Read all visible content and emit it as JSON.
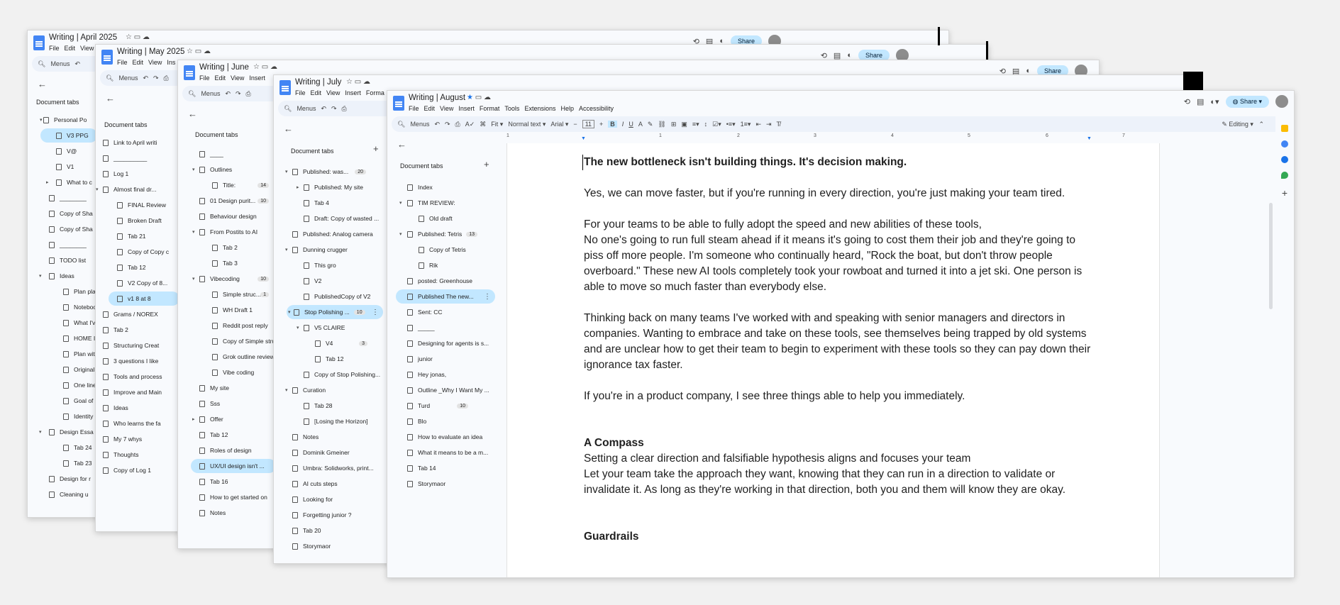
{
  "w1": {
    "title": "Writing | April 2025",
    "menus": [
      "File",
      "Edit",
      "View"
    ],
    "search": "Menus",
    "share": "Share",
    "tabs": [
      "Personal Po",
      "V3 PPG",
      "V@",
      "V1",
      "What to c",
      "________",
      "Copy of Sha",
      "Copy of Sha",
      "________",
      "TODO list",
      "Ideas",
      "Plan plan",
      "Notebook",
      "What I've",
      "HOME Im",
      "Plan with",
      "Original t",
      "One liner",
      "Goal of b",
      "Identity",
      "Design Essa",
      "Tab 24",
      "Tab 23",
      "Design for r",
      "Cleaning u"
    ]
  },
  "w2": {
    "title": "Writing | May 2025",
    "menus": [
      "File",
      "Edit",
      "View",
      "Ins"
    ],
    "search": "Menus",
    "share": "Share",
    "tabs": [
      "Link to April writi",
      "__________",
      "Log 1",
      "Almost final dr...",
      "FINAL Review",
      "Broken Draft",
      "Tab 21",
      "Copy of Copy c",
      "Tab 12",
      "V2 Copy of 8...",
      "v1 8 at 8",
      "Grams / NOREX",
      "Tab 2",
      "Structuring Creat",
      "3 questions I like",
      "Tools and process",
      "Improve and Main",
      "Ideas",
      "Who learns the fa",
      "My 7 whys",
      "Thoughts",
      "Copy of Log 1"
    ]
  },
  "w3": {
    "title": "Writing | June",
    "menus": [
      "File",
      "Edit",
      "View",
      "Insert"
    ],
    "search": "Menus",
    "share": "Share",
    "tabs": [
      "____",
      "Outlines",
      "Title:",
      "01 Design purit...",
      "Behaviour design",
      "From Postits to AI",
      "Tab 2",
      "Tab 3",
      "Vibecoding",
      "Simple struc...",
      "WH Draft 1",
      "Reddit post reply",
      "Copy of Simple stru",
      "Grok outline review",
      "Vibe coding",
      "My site",
      "Sss",
      "Offer",
      "Tab 12",
      "Roles of design",
      "UX/UI design isn't ...",
      "Tab 16",
      "How to get started on",
      "Notes"
    ],
    "badges": {
      "title": "14",
      "purit": "10",
      "vibe": "10",
      "simple": "1"
    }
  },
  "w4": {
    "title": "Writing | July",
    "menus": [
      "File",
      "Edit",
      "View",
      "Insert",
      "Forma"
    ],
    "search": "Menus",
    "tabs": [
      "Published: was...",
      "Published: My site",
      "Tab 4",
      "Draft: Copy of wasted ...",
      "Published: Analog camera",
      "Dunning crugger",
      "This gro",
      "V2",
      "PublishedCopy of V2",
      "Stop Polishing ...",
      "V5 CLAIRE",
      "V4",
      "Tab 12",
      "Copy of Stop Polishing...",
      "Curation",
      "Tab 28",
      "[Losing the Horizon]",
      "Notes",
      "Dominik Gmeiner",
      "Umbra: Solidworks, print...",
      "AI cuts steps",
      "Looking for",
      "Forgetting junior ?",
      "Tab 20",
      "Storymaor"
    ],
    "badges": {
      "was": "20",
      "stop": "10",
      "v4": "3"
    }
  },
  "w5": {
    "title": "Writing | August",
    "menus": [
      "File",
      "Edit",
      "View",
      "Insert",
      "Format",
      "Tools",
      "Extensions",
      "Help",
      "Accessibility"
    ],
    "search": "Menus",
    "zoom": "Fit",
    "style": "Normal text",
    "font": "Arial",
    "size": "11",
    "editing": "Editing",
    "share": "Share",
    "doc_tabs_label": "Document tabs",
    "tabs": [
      "Index",
      "TIM REVIEW:",
      "Old draft",
      "Published: Tetris",
      "Copy of Tetris",
      "Rik",
      "posted: Greenhouse",
      "Published The new...",
      "Sent: CC",
      "_____",
      "Designing for agents is s...",
      "junior",
      "Hey jonas,",
      "Outline _Why I Want My ...",
      "Turd",
      "Blo",
      "How to evaluate an idea",
      "What it means to be a m...",
      "Tab 14",
      "Storymaor"
    ],
    "badges": {
      "tetris": "13",
      "turd": "10"
    },
    "ruler": [
      "1",
      "1",
      "2",
      "3",
      "4",
      "5",
      "6",
      "7"
    ],
    "doc": {
      "h1": "The new bottleneck isn't building things. It's decision making.",
      "p1": "Yes, we can move faster, but if you're running in every direction, you're just making your team tired.",
      "p2a": "For your teams to be able to fully adopt the speed and new abilities of these tools,",
      "p2b": "No one's going to run full steam ahead if it means it's going to cost them their job and they're going to piss off more people. I'm someone who continually heard, \"Rock the boat, but don't throw people overboard.\" These new AI tools completely took your rowboat and turned it into a jet ski. One person is able to move so much faster than everybody else.",
      "p3": "Thinking back on many teams I've worked with and speaking with senior managers and directors in companies. Wanting to embrace and take on these tools, see themselves being trapped by old systems and are unclear how to get their team to begin to experiment with these tools so they can pay down their ignorance tax faster.",
      "p4": "If you're in a product company, I see three things able to help you immediately.",
      "h2": "A Compass",
      "p5a": "Setting a clear direction and falsifiable hypothesis aligns and focuses your team",
      "p5b": "Let your team take the approach they want, knowing that they can run in a direction to validate or invalidate it. As long as they're working in that direction, both you and them will know they are okay.",
      "h3": "Guardrails"
    }
  }
}
